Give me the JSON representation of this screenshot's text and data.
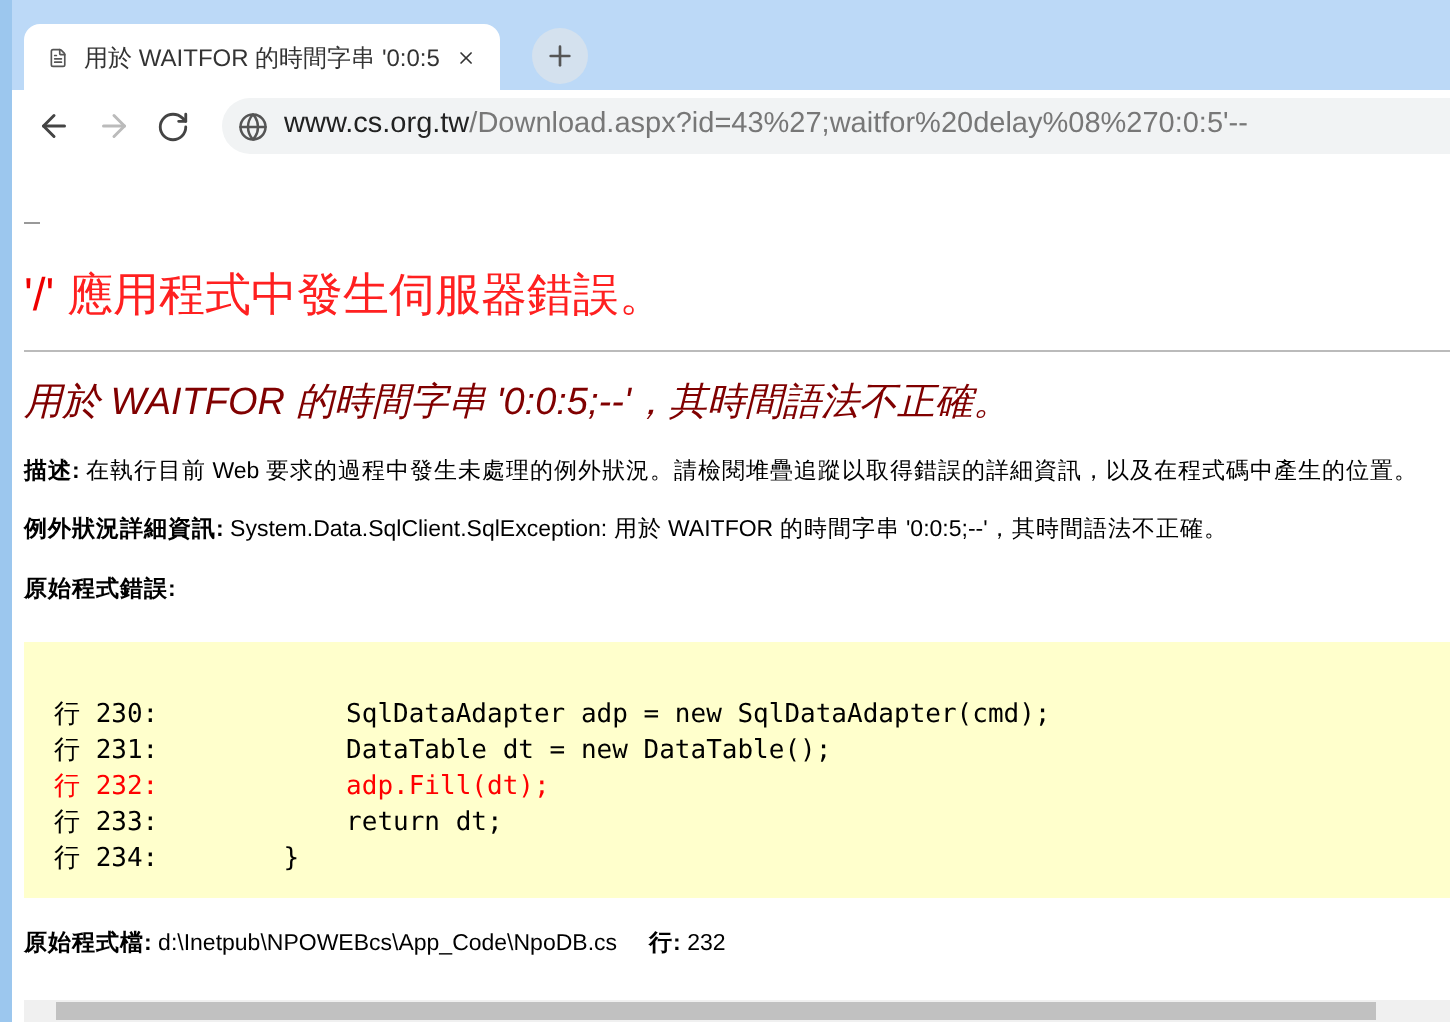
{
  "browser": {
    "tab": {
      "title": "用於 WAITFOR 的時間字串 '0:0:5"
    },
    "address": {
      "domain": "www.cs.org.tw",
      "path": "/Download.aspx?id=43%27;waitfor%20delay%08%270:0:5'--"
    }
  },
  "page": {
    "heading_app": "'/'",
    "heading_rest": "應用程式中發生伺服器錯誤。",
    "error_title": "用於 WAITFOR 的時間字串 '0:0:5;--'，其時間語法不正確。",
    "fields": [
      {
        "label": "描述:",
        "value": "在執行目前 Web 要求的過程中發生未處理的例外狀況。請檢閱堆疊追蹤以取得錯誤的詳細資訊，以及在程式碼中產生的位置。"
      },
      {
        "label": "例外狀況詳細資訊:",
        "value": "System.Data.SqlClient.SqlException: 用於 WAITFOR 的時間字串 '0:0:5;--'，其時間語法不正確。"
      }
    ],
    "source_error_label": "原始程式錯誤:",
    "code_lines": [
      {
        "text": "行 230:            SqlDataAdapter adp = new SqlDataAdapter(cmd);",
        "highlighted": false
      },
      {
        "text": "行 231:            DataTable dt = new DataTable();",
        "highlighted": false
      },
      {
        "text": "行 232:            adp.Fill(dt);",
        "highlighted": true
      },
      {
        "text": "行 233:            return dt;",
        "highlighted": false
      },
      {
        "text": "行 234:        }",
        "highlighted": false
      }
    ],
    "source_file": {
      "label": "原始程式檔:",
      "path": "d:\\Inetpub\\NPOWEBcs\\App_Code\\NpoDB.cs",
      "line_label": "行:",
      "line": "232"
    }
  }
}
